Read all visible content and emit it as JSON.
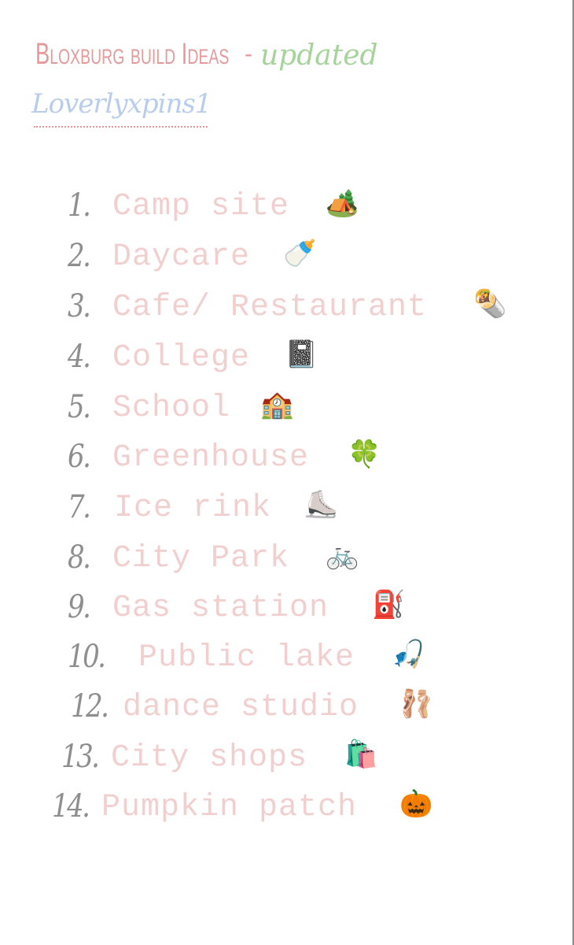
{
  "header": {
    "title": "Bloxburg build Ideas",
    "separator": "-",
    "updated": "updated",
    "author": "Loverlyxpins1"
  },
  "colors": {
    "title": "#e59a9a",
    "updated": "#a5d39b",
    "author": "#b8cdee",
    "number": "#8e8e8e",
    "item": "#f2cfcf"
  },
  "items": [
    {
      "number": "1.",
      "label": "Camp site",
      "icon": "camping-icon",
      "emoji": "🏕️"
    },
    {
      "number": "2.",
      "label": "Daycare",
      "icon": "baby-bottle-icon",
      "emoji": "🍼"
    },
    {
      "number": "3.",
      "label": "Cafe/ Restaurant",
      "icon": "burrito-icon",
      "emoji": "🌯"
    },
    {
      "number": "4.",
      "label": "College",
      "icon": "notebook-icon",
      "emoji": "📓"
    },
    {
      "number": "5.",
      "label": "School",
      "icon": "school-icon",
      "emoji": "🏫"
    },
    {
      "number": "6.",
      "label": "Greenhouse",
      "icon": "four-leaf-clover-icon",
      "emoji": "🍀"
    },
    {
      "number": "7.",
      "label": "Ice rink",
      "icon": "ice-skate-icon",
      "emoji": "⛸️"
    },
    {
      "number": "8.",
      "label": "City Park",
      "icon": "bicycle-icon",
      "emoji": "🚲"
    },
    {
      "number": "9.",
      "label": "Gas station",
      "icon": "fuel-pump-icon",
      "emoji": "⛽"
    },
    {
      "number": "10.",
      "label": "Public lake",
      "icon": "fishing-pole-icon",
      "emoji": "🎣"
    },
    {
      "number": "12.",
      "label": "dance studio",
      "icon": "ballet-shoes-icon",
      "emoji": "🩰"
    },
    {
      "number": "13.",
      "label": "City shops",
      "icon": "shopping-bags-icon",
      "emoji": "🛍️"
    },
    {
      "number": "14.",
      "label": "Pumpkin patch",
      "icon": "jack-o-lantern-icon",
      "emoji": "🎃"
    }
  ]
}
